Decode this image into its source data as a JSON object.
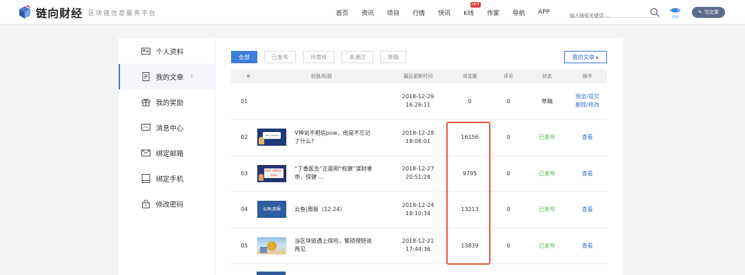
{
  "header": {
    "brand": "链向财经",
    "tagline": "区块链信息服务平台",
    "nav": [
      "首页",
      "资讯",
      "项目",
      "行情",
      "快讯",
      "K线",
      "作家",
      "导航",
      "APP"
    ],
    "hot_badge": "HOT",
    "search_placeholder": "输入搜索关键词 ...",
    "fish_label": "FISH",
    "write_label": "写文章"
  },
  "sidebar": {
    "items": [
      {
        "label": "个人资料",
        "icon": "id-card-icon"
      },
      {
        "label": "我的文章",
        "icon": "document-icon",
        "active": true,
        "arrow": "›"
      },
      {
        "label": "我的奖励",
        "icon": "gift-icon"
      },
      {
        "label": "消息中心",
        "icon": "message-icon"
      },
      {
        "label": "绑定邮箱",
        "icon": "mail-icon"
      },
      {
        "label": "绑定手机",
        "icon": "phone-icon"
      },
      {
        "label": "修改密码",
        "icon": "lock-icon"
      }
    ]
  },
  "main": {
    "tabs": [
      "全部",
      "已发布",
      "待审核",
      "未通过",
      "草稿"
    ],
    "my_articles_btn": "我的文章 ▸",
    "columns": [
      "#",
      "封面/标题",
      "最后更新时间",
      "浏览量",
      "评论",
      "状态",
      "操作"
    ],
    "rows": [
      {
        "num": "01",
        "title": "",
        "date": "2018-12-29",
        "time": "16:26:11",
        "views": "0",
        "comments": "0",
        "status": "草稿",
        "op1": "预览/提交",
        "op2": "删除/修改"
      },
      {
        "num": "02",
        "title": "V神说不相信pow，他是不忘记了什么?",
        "date": "2018-12-28",
        "time": "18:08:01",
        "views": "16156",
        "comments": "0",
        "status": "已发布",
        "op1": "查看",
        "thumb_text": "\"who\" believe"
      },
      {
        "num": "03",
        "title": "“丁香医生”正面刚“权健”谋财害命，保健 ...",
        "date": "2018-12-27",
        "time": "20:51:28",
        "views": "9795",
        "comments": "0",
        "status": "已发布",
        "op1": "查看",
        "thumb_text": "区块链一般都是全个写局吗?"
      },
      {
        "num": "04",
        "title": "云鱼|周报（12.24）",
        "date": "2018-12-24",
        "time": "18:10:34",
        "views": "13213",
        "comments": "0",
        "status": "已发布",
        "op1": "查看",
        "thumb_text": "云鱼|周报"
      },
      {
        "num": "05",
        "title": "当区块链遇上保险，繁琐理赔说再见",
        "date": "2018-12-21",
        "time": "17:44:36",
        "views": "13839",
        "comments": "0",
        "status": "已发布",
        "op1": "查看"
      }
    ]
  },
  "colors": {
    "accent": "#3b7dd8",
    "published": "#5cb85c",
    "highlight": "#e5533b"
  }
}
